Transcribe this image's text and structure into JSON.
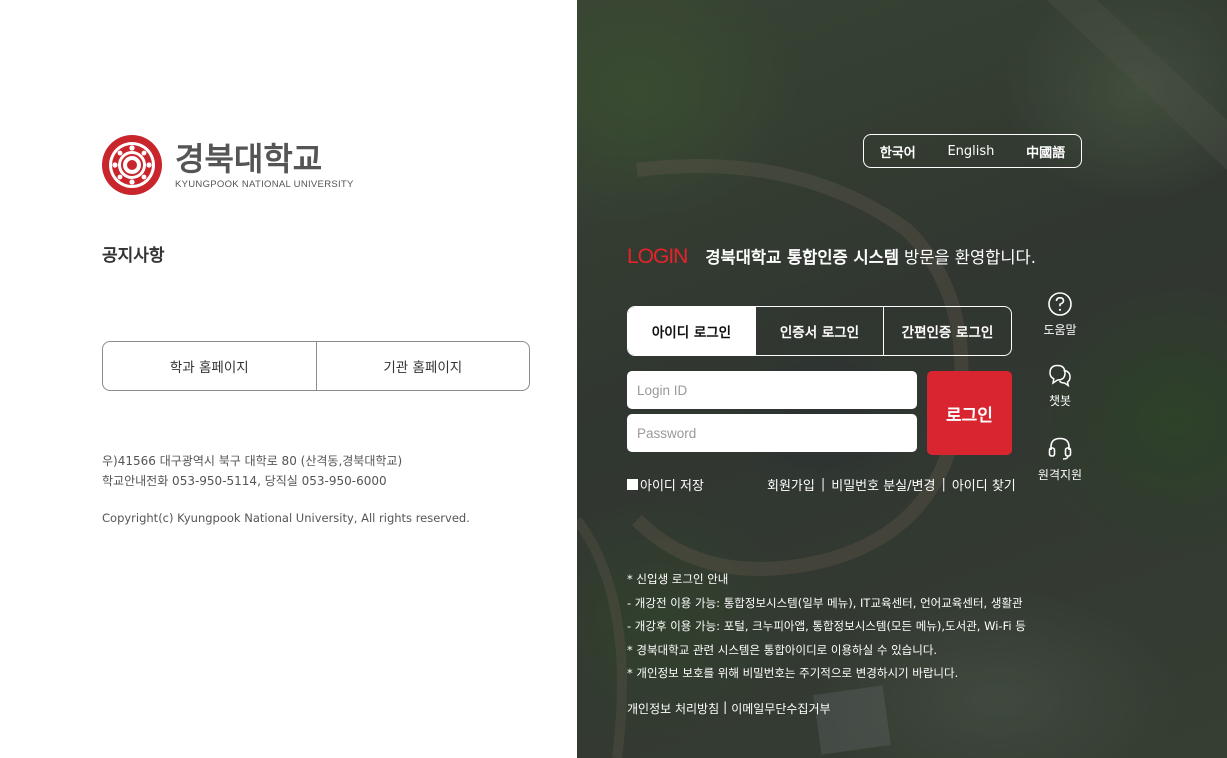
{
  "logo": {
    "name_ko": "경북대학교",
    "name_en": "KYUNGPOOK NATIONAL UNIVERSITY",
    "seal_ring_text": "KYUNGPOOK NATIONAL UNIVERSITY",
    "seal_inner_text": "경북대학교"
  },
  "notice": {
    "title": "공지사항"
  },
  "links": {
    "dept_homepage": "학과 홈페이지",
    "org_homepage": "기관 홈페이지"
  },
  "address": {
    "line1": "우)41566 대구광역시 북구 대학로 80 (산격동,경북대학교)",
    "line2": "학교안내전화 053-950-5114, 당직실 053-950-6000"
  },
  "copyright": "Copyright(c) Kyungpook National University, All rights reserved.",
  "language": {
    "items": [
      "한국어",
      "English",
      "中國語"
    ],
    "active": "한국어"
  },
  "welcome": {
    "login_word": "LOGIN",
    "bold": "경북대학교 통합인증 시스템",
    "rest": "방문을 환영합니다."
  },
  "login_tabs": [
    "아이디 로그인",
    "인증서 로그인",
    "간편인증 로그인"
  ],
  "form": {
    "id_placeholder": "Login ID",
    "pw_placeholder": "Password",
    "login_button": "로그인",
    "save_id": "아이디 저장",
    "signup": "회원가입",
    "find_pw": "비밀번호 분실/변경",
    "find_id": "아이디 찾기"
  },
  "side": {
    "help": "도움말",
    "chatbot": "챗봇",
    "remote": "원격지원"
  },
  "info_lines": [
    "* 신입생 로그인 안내",
    "- 개강전 이용 가능: 통합정보시스템(일부 메뉴), IT교육센터, 언어교육센터, 생활관",
    "- 개강후 이용 가능: 포털, 크누피아앱, 통합정보시스템(모든 메뉴),도서관, Wi-Fi 등",
    "* 경북대학교 관련 시스템은 통합아이디로 이용하실 수 있습니다.",
    "* 개인정보 보호를 위해 비밀번호는 주기적으로 변경하시기 바랍니다."
  ],
  "footer": {
    "privacy": "개인정보 처리방침",
    "email_refuse": "이메일무단수집거부"
  },
  "colors": {
    "accent_red": "#d9252f",
    "login_word_red": "#e8222b",
    "seal_red": "#c8252c"
  }
}
